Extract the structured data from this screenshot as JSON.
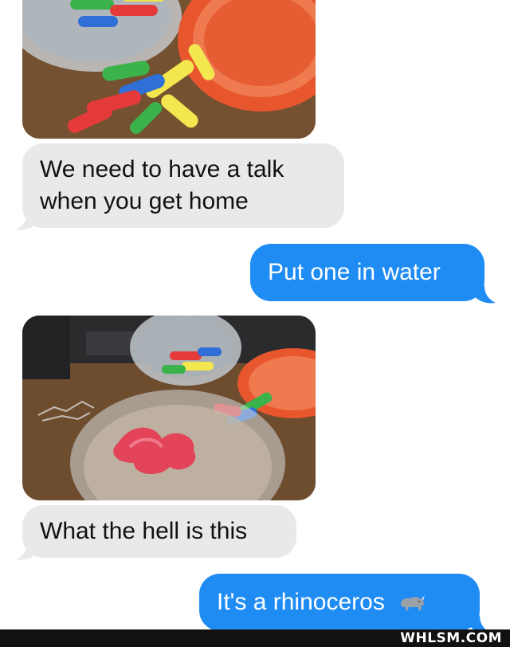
{
  "conversation": {
    "messages": [
      {
        "sender": "them",
        "type": "photo",
        "icon": "pills-bowl-photo"
      },
      {
        "sender": "them",
        "type": "text",
        "text": "We need to have a talk when you get home"
      },
      {
        "sender": "me",
        "type": "text",
        "text": "Put one in water"
      },
      {
        "sender": "them",
        "type": "photo",
        "icon": "pill-in-water-photo"
      },
      {
        "sender": "them",
        "type": "text",
        "text": "What the hell is this"
      },
      {
        "sender": "me",
        "type": "text",
        "text": "It's a rhinoceros",
        "emoji": "rhinoceros-emoji"
      }
    ]
  },
  "colors": {
    "received_bubble": "#e9e9eb",
    "sent_bubble": "#1f8cf4",
    "footer_bar": "#111111"
  },
  "watermark": {
    "text": "WHLSM.COM"
  }
}
